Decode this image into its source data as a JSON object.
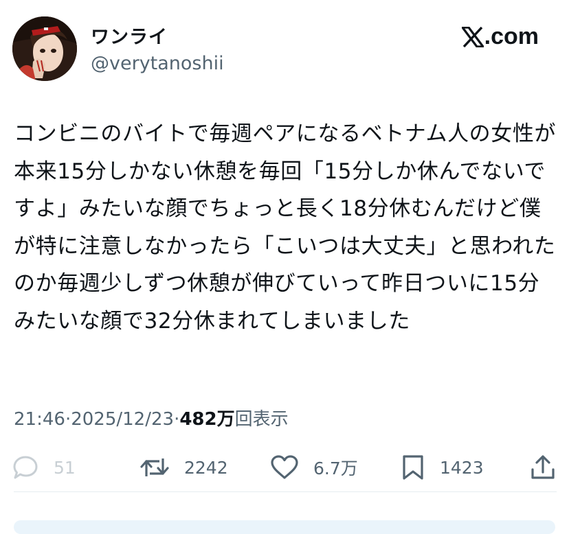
{
  "author": {
    "display_name": "ワンライ",
    "handle": "@verytanoshii"
  },
  "site": {
    "label": ".com",
    "icon": "x-logo-icon"
  },
  "tweet": {
    "text": "コンビニのバイトで毎週ペアになるベトナム人の女性が本来15分しかない休憩を毎回「15分しか休んでないですよ」みたいな顔でちょっと長く18分休むんだけど僕が特に注意しなかったら「こいつは大丈夫」と思われたのか毎週少しずつ休憩が伸びていって昨日ついに15分みたいな顔で32分休まれてしまいました"
  },
  "meta": {
    "time": "21:46",
    "separator": " · ",
    "date": "2025/12/23",
    "views_count": "482万",
    "views_suffix": "回表示"
  },
  "actions": {
    "reply": {
      "icon": "reply-bubble-icon",
      "count": "51"
    },
    "repost": {
      "icon": "repost-icon",
      "count": "2242"
    },
    "like": {
      "icon": "heart-icon",
      "count": "6.7万"
    },
    "bookmark": {
      "icon": "bookmark-icon",
      "count": "1423"
    },
    "share": {
      "icon": "share-icon"
    }
  },
  "colors": {
    "text": "#0f1419",
    "secondary": "#536471",
    "disabled": "#c8cfd4",
    "divider": "#e6ecf0"
  }
}
